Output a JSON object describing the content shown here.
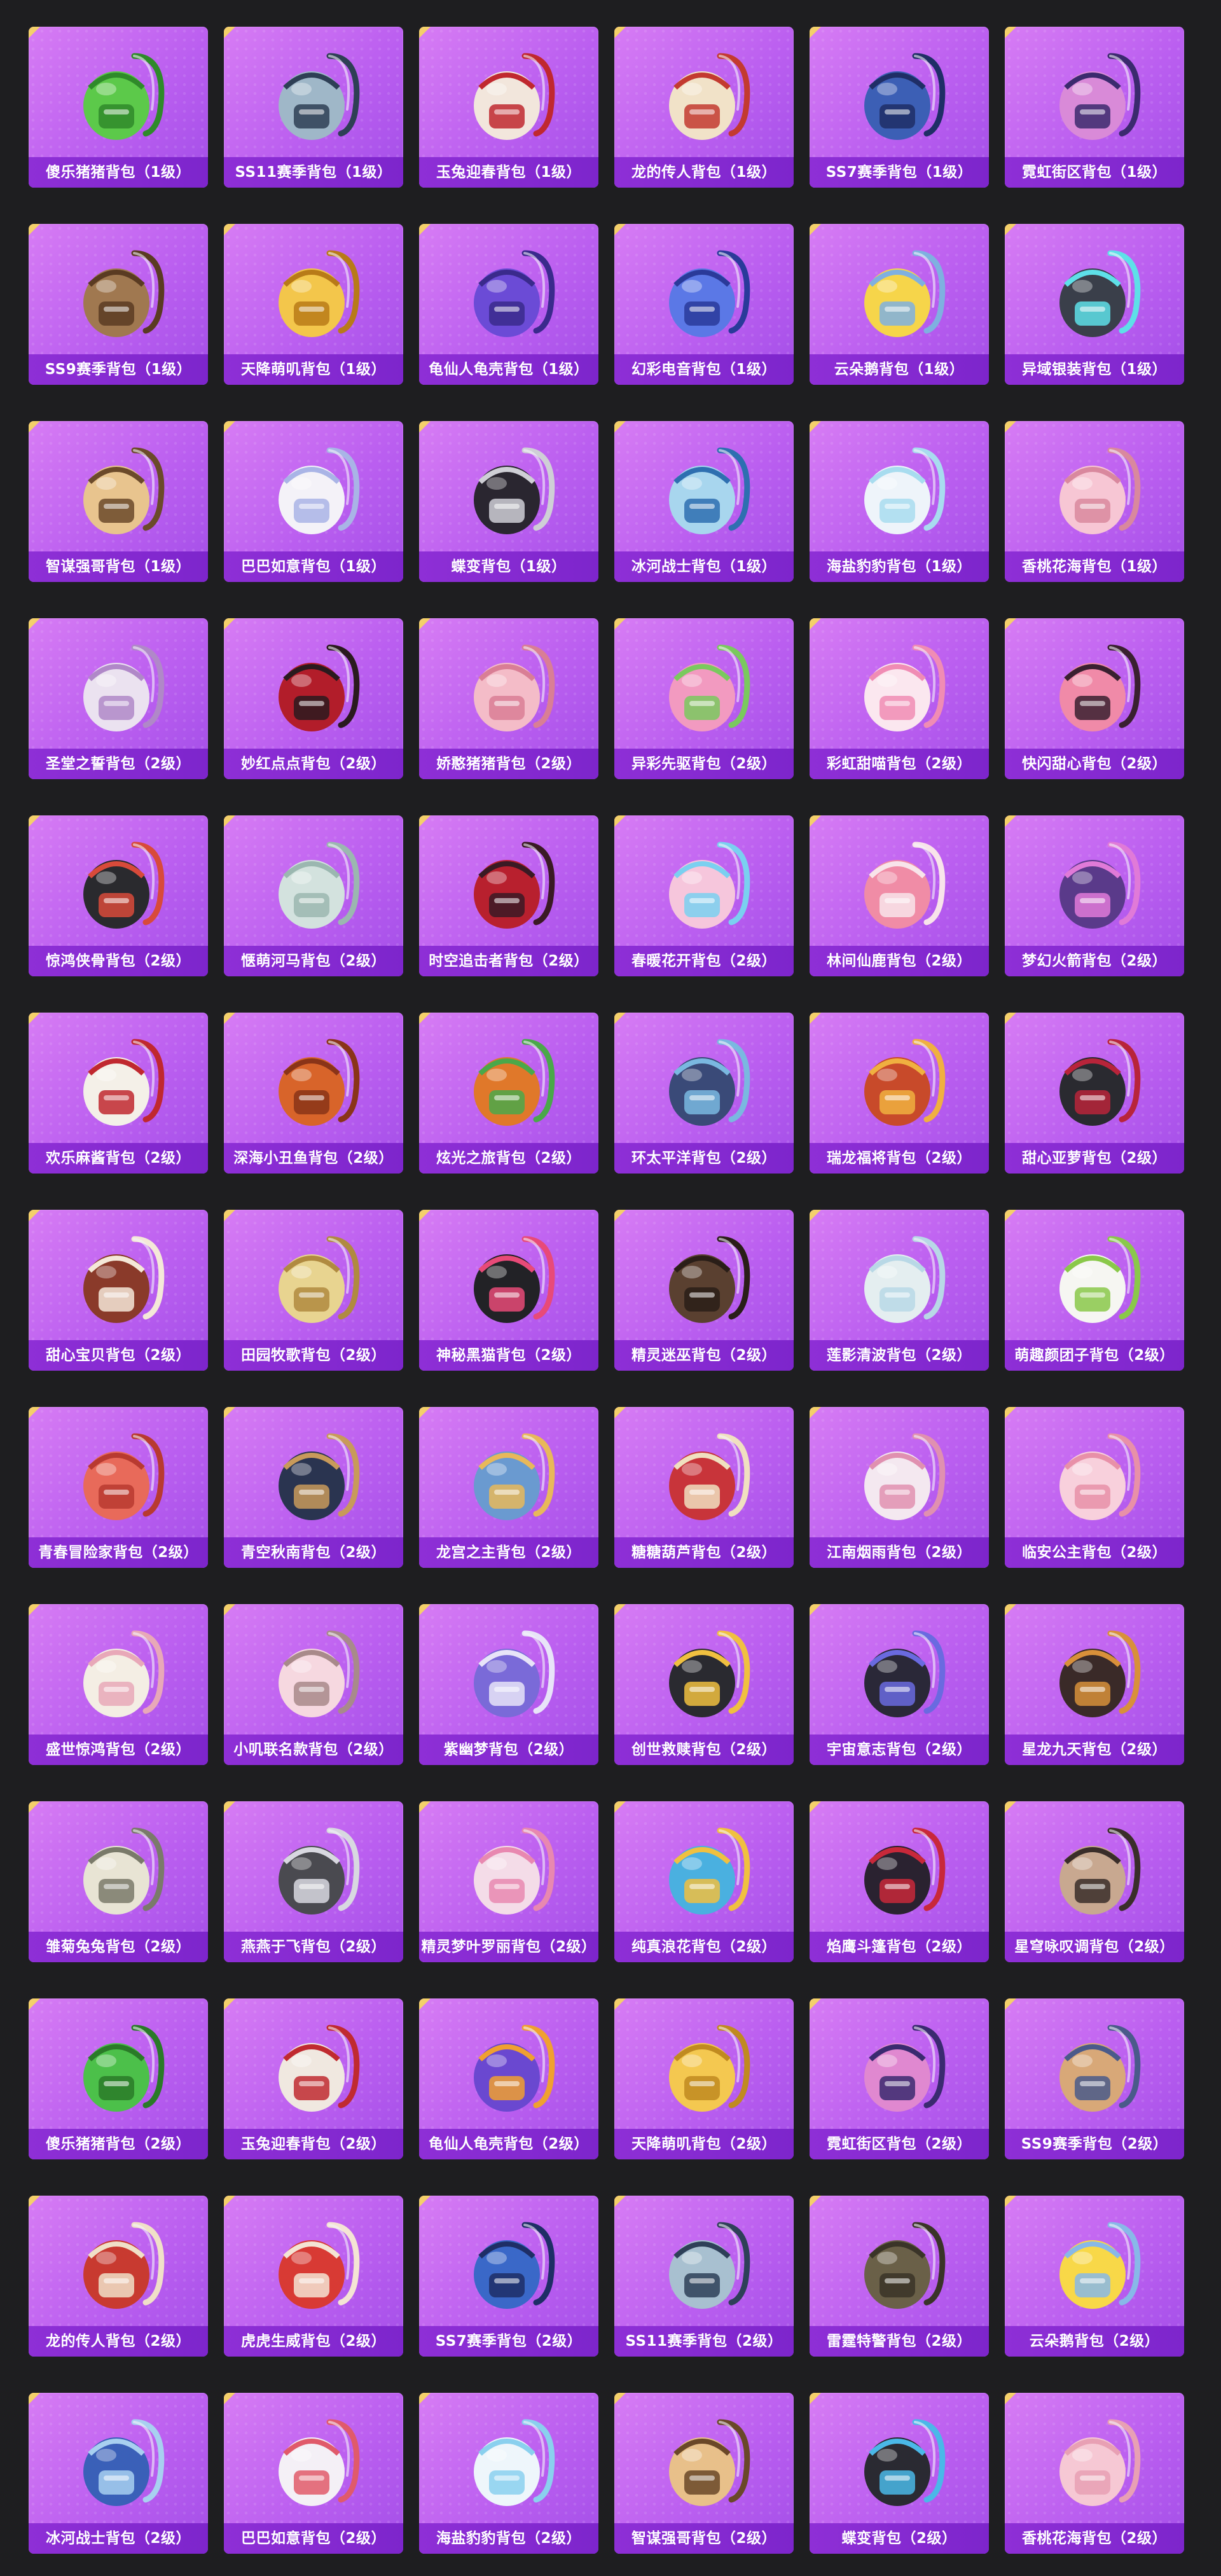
{
  "items": [
    {
      "name": "傻乐猪猪背包（1级）",
      "color": "#5cc94a",
      "accent": "#2f8a2a"
    },
    {
      "name": "SS11赛季背包（1级）",
      "color": "#9fb7c8",
      "accent": "#2e3f55"
    },
    {
      "name": "玉兔迎春背包（1级）",
      "color": "#f2e6dc",
      "accent": "#c0282f"
    },
    {
      "name": "龙的传人背包（1级）",
      "color": "#f1e2c8",
      "accent": "#c33a30"
    },
    {
      "name": "SS7赛季背包（1级）",
      "color": "#3c5fb5",
      "accent": "#1f2e66"
    },
    {
      "name": "霓虹街区背包（1级）",
      "color": "#d98ad8",
      "accent": "#3b2a6e"
    },
    {
      "name": "SS9赛季背包（1级）",
      "color": "#a07850",
      "accent": "#5a3b22"
    },
    {
      "name": "天降萌叽背包（1级）",
      "color": "#f3c64b",
      "accent": "#b87a18"
    },
    {
      "name": "龟仙人龟壳背包（1级）",
      "color": "#6b4bd6",
      "accent": "#3a2a8c"
    },
    {
      "name": "幻彩电音背包（1级）",
      "color": "#5b78e6",
      "accent": "#2a3a9a"
    },
    {
      "name": "云朵鹅背包（1级）",
      "color": "#f6d54a",
      "accent": "#7fb0e0"
    },
    {
      "name": "异域银装背包（1级）",
      "color": "#3a3f4a",
      "accent": "#5ee0e8"
    },
    {
      "name": "智谋强哥背包（1级）",
      "color": "#e8c48e",
      "accent": "#6b4a2a"
    },
    {
      "name": "巴巴如意背包（1级）",
      "color": "#f4f2f8",
      "accent": "#a9b4e6"
    },
    {
      "name": "蝶变背包（1级）",
      "color": "#2a2630",
      "accent": "#cfcfd6"
    },
    {
      "name": "冰河战士背包（1级）",
      "color": "#a8d6ee",
      "accent": "#2e6fb0"
    },
    {
      "name": "海盐豹豹背包（1级）",
      "color": "#eef4fa",
      "accent": "#a8dcef"
    },
    {
      "name": "香桃花海背包（1级）",
      "color": "#f7c6d4",
      "accent": "#d9889e"
    },
    {
      "name": "圣堂之誓背包（2级）",
      "color": "#ebe2f0",
      "accent": "#b088c8"
    },
    {
      "name": "妙红点点背包（2级）",
      "color": "#b21d2a",
      "accent": "#2a1a1e"
    },
    {
      "name": "娇憨猪猪背包（2级）",
      "color": "#f4bcc8",
      "accent": "#d97e95"
    },
    {
      "name": "异彩先驱背包（2级）",
      "color": "#f29ac0",
      "accent": "#7ac95e"
    },
    {
      "name": "彩虹甜喵背包（2级）",
      "color": "#fbe7ef",
      "accent": "#f08cb4"
    },
    {
      "name": "快闪甜心背包（2级）",
      "color": "#f08aa8",
      "accent": "#3a2030"
    },
    {
      "name": "惊鸿侠骨背包（2级）",
      "color": "#2a2a2e",
      "accent": "#d84a3a"
    },
    {
      "name": "惬萌河马背包（2级）",
      "color": "#d3e2de",
      "accent": "#9bb7b0"
    },
    {
      "name": "时空追击者背包（2级）",
      "color": "#b8202e",
      "accent": "#3a1a24"
    },
    {
      "name": "春暖花开背包（2级）",
      "color": "#f6c6dc",
      "accent": "#7ad0f0"
    },
    {
      "name": "林间仙鹿背包（2级）",
      "color": "#f08ca6",
      "accent": "#f8e4ea"
    },
    {
      "name": "梦幻火箭背包（2级）",
      "color": "#5a3a8a",
      "accent": "#e07ad8"
    },
    {
      "name": "欢乐麻酱背包（2级）",
      "color": "#f4f0e8",
      "accent": "#c0282f"
    },
    {
      "name": "深海小丑鱼背包（2级）",
      "color": "#d8642a",
      "accent": "#8a3418"
    },
    {
      "name": "炫光之旅背包（2级）",
      "color": "#e0782a",
      "accent": "#4aa84a"
    },
    {
      "name": "环太平洋背包（2级）",
      "color": "#3a4a78",
      "accent": "#7ab8e0"
    },
    {
      "name": "瑞龙福将背包（2级）",
      "color": "#c84a2a",
      "accent": "#f0b040"
    },
    {
      "name": "甜心亚萝背包（2级）",
      "color": "#2a2a30",
      "accent": "#b8243a"
    },
    {
      "name": "甜心宝贝背包（2级）",
      "color": "#8a3a2a",
      "accent": "#f4e8d8"
    },
    {
      "name": "田园牧歌背包（2级）",
      "color": "#e8d490",
      "accent": "#b08a40"
    },
    {
      "name": "神秘黑猫背包（2级）",
      "color": "#222226",
      "accent": "#e84a78"
    },
    {
      "name": "精灵迷巫背包（2级）",
      "color": "#5a4030",
      "accent": "#2a1e18"
    },
    {
      "name": "莲影清波背包（2级）",
      "color": "#e4eef0",
      "accent": "#b8d8e6"
    },
    {
      "name": "萌趣颜团子背包（2级）",
      "color": "#f6f6f2",
      "accent": "#8ac84a"
    },
    {
      "name": "青春冒险家背包（2级）",
      "color": "#e86a5a",
      "accent": "#b83a30"
    },
    {
      "name": "青空秋南背包（2级）",
      "color": "#2a3450",
      "accent": "#c89a5a"
    },
    {
      "name": "龙宫之主背包（2级）",
      "color": "#6a9ad0",
      "accent": "#e8b85a"
    },
    {
      "name": "糖糖葫芦背包（2级）",
      "color": "#c8343a",
      "accent": "#f0e0c0"
    },
    {
      "name": "江南烟雨背包（2级）",
      "color": "#f4e8f0",
      "accent": "#e090b0"
    },
    {
      "name": "临安公主背包（2级）",
      "color": "#f8d0dc",
      "accent": "#e890a8"
    },
    {
      "name": "盛世惊鸿背包（2级）",
      "color": "#f4eee4",
      "accent": "#e8a8b8"
    },
    {
      "name": "小叽联名款背包（2级）",
      "color": "#f6d8e0",
      "accent": "#a88a8a"
    },
    {
      "name": "紫幽梦背包（2级）",
      "color": "#7a6ad8",
      "accent": "#e8e4f8"
    },
    {
      "name": "创世救赎背包（2级）",
      "color": "#2a2a30",
      "accent": "#f0c040"
    },
    {
      "name": "宇宙意志背包（2级）",
      "color": "#2a2838",
      "accent": "#6a6ae0"
    },
    {
      "name": "星龙九天背包（2级）",
      "color": "#3a2a28",
      "accent": "#d8903a"
    },
    {
      "name": "雏菊兔兔背包（2级）",
      "color": "#e8e4d4",
      "accent": "#7a7a6a"
    },
    {
      "name": "燕燕于飞背包（2级）",
      "color": "#4a4a50",
      "accent": "#d8d8e0"
    },
    {
      "name": "精灵梦叶罗丽背包（2级）",
      "color": "#f4dce8",
      "accent": "#e888b0"
    },
    {
      "name": "纯真浪花背包（2级）",
      "color": "#4ab0e0",
      "accent": "#f0c040"
    },
    {
      "name": "焰鹰斗篷背包（2级）",
      "color": "#2a2230",
      "accent": "#c8283a"
    },
    {
      "name": "星穹咏叹调背包（2级）",
      "color": "#c8a890",
      "accent": "#3a2e2a"
    },
    {
      "name": "傻乐猪猪背包（2级）",
      "color": "#4cc04a",
      "accent": "#2a7a28"
    },
    {
      "name": "玉兔迎春背包（2级）",
      "color": "#f0e8e0",
      "accent": "#c02a30"
    },
    {
      "name": "龟仙人龟壳背包（2级）",
      "color": "#6a48d0",
      "accent": "#f0a030"
    },
    {
      "name": "天降萌叽背包（2级）",
      "color": "#f4c850",
      "accent": "#c08a20"
    },
    {
      "name": "霓虹街区背包（2级）",
      "color": "#e088d0",
      "accent": "#3a2a70"
    },
    {
      "name": "SS9赛季背包（2级）",
      "color": "#d8a878",
      "accent": "#4a5a8a"
    },
    {
      "name": "龙的传人背包（2级）",
      "color": "#c83a30",
      "accent": "#f0e0c8"
    },
    {
      "name": "虎虎生威背包（2级）",
      "color": "#d83a34",
      "accent": "#f4e4d4"
    },
    {
      "name": "SS7赛季背包（2级）",
      "color": "#3a68c8",
      "accent": "#1e2e66"
    },
    {
      "name": "SS11赛季背包（2级）",
      "color": "#a8c0d0",
      "accent": "#2e4058"
    },
    {
      "name": "雷霆特警背包（2级）",
      "color": "#6a6048",
      "accent": "#3a3428"
    },
    {
      "name": "云朵鹅背包（2级）",
      "color": "#f8d848",
      "accent": "#88b8e8"
    },
    {
      "name": "冰河战士背包（2级）",
      "color": "#3a60b8",
      "accent": "#a8d0f0"
    },
    {
      "name": "巴巴如意背包（2级）",
      "color": "#f4f0f6",
      "accent": "#e05a6a"
    },
    {
      "name": "海盐豹豹背包（2级）",
      "color": "#eef6fb",
      "accent": "#8ad0ee"
    },
    {
      "name": "智谋强哥背包（2级）",
      "color": "#e8c08a",
      "accent": "#6a4828"
    },
    {
      "name": "蝶变背包（2级）",
      "color": "#2a2a32",
      "accent": "#4ab8e8"
    },
    {
      "name": "香桃花海背包（2级）",
      "color": "#f6c8d4",
      "accent": "#e8a0b4"
    }
  ]
}
